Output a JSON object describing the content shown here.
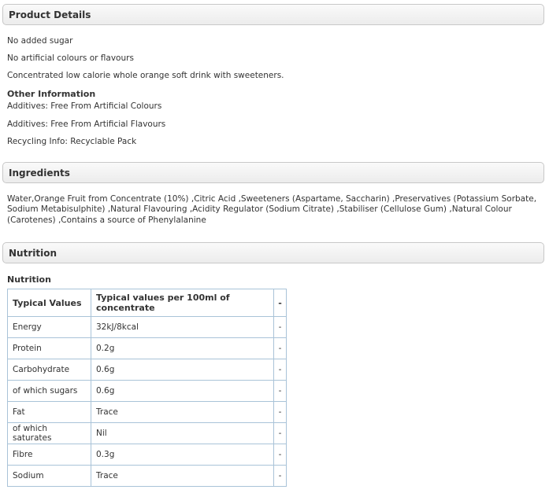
{
  "product_details": {
    "header": "Product Details",
    "lines": [
      "No added sugar",
      "No artificial colours or flavours",
      "Concentrated low calorie whole orange soft drink with sweeteners."
    ],
    "other_info_title": "Other Information",
    "other_info": [
      "Additives: Free From Artificial Colours",
      "Additives: Free From Artificial Flavours",
      "Recycling Info: Recyclable Pack"
    ]
  },
  "ingredients": {
    "header": "Ingredients",
    "text": "Water,Orange Fruit from Concentrate (10%) ,Citric Acid ,Sweeteners (Aspartame, Saccharin) ,Preservatives (Potassium Sorbate, Sodium Metabisulphite) ,Natural Flavouring ,Acidity Regulator (Sodium Citrate) ,Stabiliser (Cellulose Gum) ,Natural Colour (Carotenes) ,Contains a source of Phenylalanine"
  },
  "nutrition": {
    "header": "Nutrition",
    "subtitle": "Nutrition",
    "columns": [
      "Typical Values",
      "Typical values per 100ml of concentrate",
      "-"
    ],
    "rows": [
      [
        "Energy",
        "32kJ/8kcal",
        "-"
      ],
      [
        "Protein",
        "0.2g",
        "-"
      ],
      [
        "Carbohydrate",
        "0.6g",
        "-"
      ],
      [
        "of which sugars",
        "0.6g",
        "-"
      ],
      [
        "Fat",
        "Trace",
        "-"
      ],
      [
        "of which saturates",
        "Nil",
        "-"
      ],
      [
        "Fibre",
        "0.3g",
        "-"
      ],
      [
        "Sodium",
        "Trace",
        "-"
      ]
    ]
  }
}
